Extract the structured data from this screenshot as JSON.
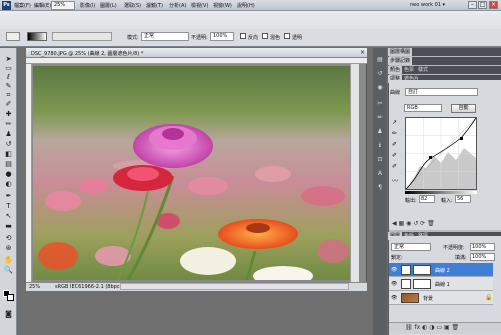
{
  "app": {
    "logo": "Ps",
    "menus": [
      "檔案(F)",
      "編輯(E)",
      "影像(I)",
      "圖層(L)",
      "選取(S)",
      "濾鏡(T)",
      "分析(A)",
      "檢視(V)",
      "視窗(W)",
      "說明(H)"
    ],
    "zoom": "25%",
    "workspace": "neo work 01 ▾"
  },
  "options": {
    "mode_label": "模式:",
    "mode_value": "正常",
    "opacity_label": "不透明:",
    "opacity_value": "100%",
    "reverse": "反向",
    "dither": "混色",
    "transparency": "透明"
  },
  "document": {
    "title": "DSC_9780.JPG @ 25% (曲線 2, 圖層遮色片/8) *",
    "status_zoom": "25%",
    "status_info": "sRGB IEC61966-2.1 (8bpc)"
  },
  "panels": {
    "top_tabs_1": [
      "圖層構圖",
      "步驟記錄"
    ],
    "top_tabs_2": [
      "顏色",
      "色票",
      "樣式"
    ],
    "adj_tabs": [
      "調整",
      "遮色片"
    ],
    "curves": {
      "title": "曲線",
      "preset": "自訂",
      "channel": "RGB",
      "auto": "自動",
      "output_label": "輸出:",
      "output_value": "82",
      "input_label": "輸入:",
      "input_value": "56"
    },
    "layers_tabs": [
      "圖層",
      "色版",
      "路徑"
    ],
    "layers_mode": "正常",
    "layers_opacity_label": "不透明度:",
    "layers_opacity": "100%",
    "lock_label": "鎖定:",
    "fill_label": "填滿:",
    "fill_value": "100%",
    "layers": [
      {
        "name": "曲線 2",
        "selected": true
      },
      {
        "name": "曲線 1",
        "selected": false
      },
      {
        "name": "背景",
        "selected": false
      }
    ]
  }
}
